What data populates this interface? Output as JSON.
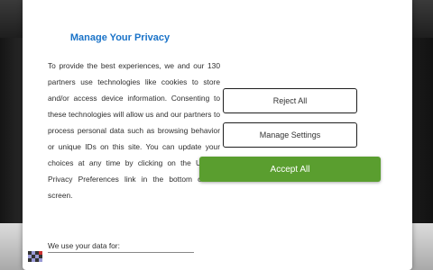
{
  "dialog": {
    "title": "Manage Your Privacy",
    "body": "To provide the best experiences, we and our 130 partners use technologies like cookies to store and/or access device information. Consenting to these technologies will allow us and our partners to process personal data such as browsing behavior or unique IDs on this site. You can update your choices at any time by clicking on the Update Privacy Preferences link in the bottom of the screen.",
    "use_data_label": "We use your data for:"
  },
  "buttons": {
    "reject": "Reject All",
    "manage": "Manage Settings",
    "accept": "Accept All"
  },
  "colors": {
    "title": "#1a73c8",
    "accept_bg": "#5a9e2f"
  },
  "icons": {
    "logo": "consent-logo-icon"
  }
}
